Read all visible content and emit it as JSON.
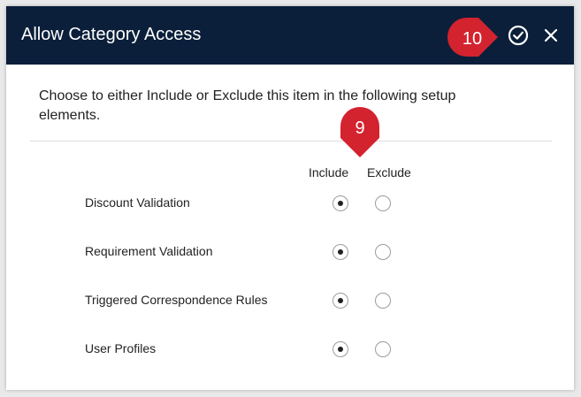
{
  "dialog": {
    "title": "Allow Category Access",
    "confirm_icon": "check-circle-icon",
    "close_icon": "close-icon"
  },
  "intro_text": "Choose to either Include or Exclude this item in the following setup elements.",
  "columns": {
    "include": "Include",
    "exclude": "Exclude"
  },
  "rows": [
    {
      "label": "Discount Validation",
      "selected": "include"
    },
    {
      "label": "Requirement Validation",
      "selected": "include"
    },
    {
      "label": "Triggered Correspondence Rules",
      "selected": "include"
    },
    {
      "label": "User Profiles",
      "selected": "include"
    }
  ],
  "callouts": [
    {
      "number": "10"
    },
    {
      "number": "9"
    }
  ],
  "colors": {
    "header_bg": "#0b1f3a",
    "callout_red": "#d3232f"
  }
}
